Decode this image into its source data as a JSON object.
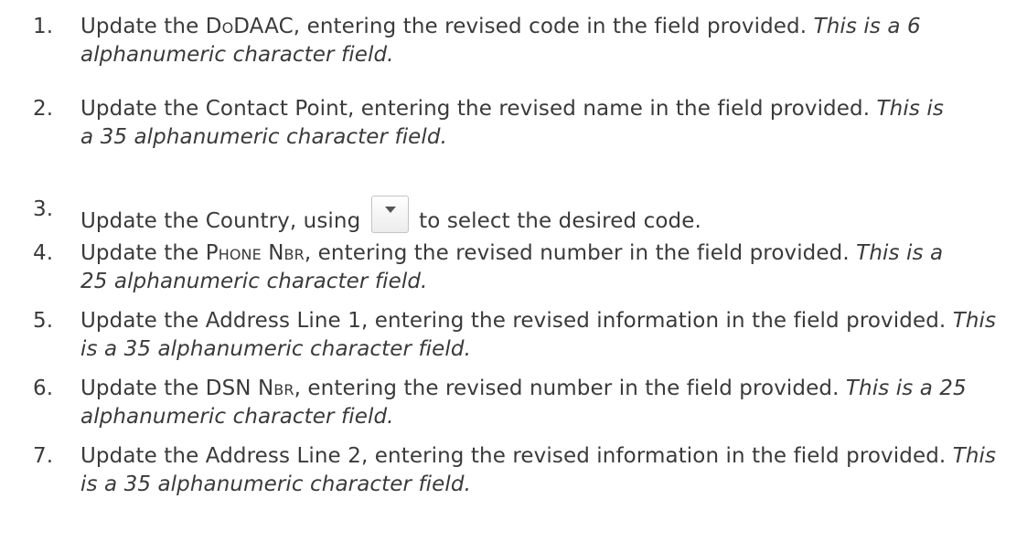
{
  "steps": [
    {
      "number": "1.",
      "pre": "Update the ",
      "term": "DoDAAC",
      "mid": ", entering the revised code in the field provided. ",
      "note": "This is a 6 alphanumeric character field."
    },
    {
      "number": "2.",
      "pre": "Update the Contact Point, entering the revised name in the field provided. ",
      "note": "This is a 35 alphanumeric character field."
    },
    {
      "number": "3.",
      "pre": "Update the Country, using",
      "icon": "dropdown-arrow-icon",
      "post": "to select the desired code."
    },
    {
      "number": "4.",
      "pre": "Update the ",
      "term": "Phone Nbr",
      "mid": ", entering the revised number in the field provided. ",
      "note": "This is a 25 alphanumeric character field."
    },
    {
      "number": "5.",
      "pre": "Update the Address Line 1, entering the revised information in the field provided. ",
      "note": "This is a 35 alphanumeric character field."
    },
    {
      "number": "6.",
      "pre": "Update the ",
      "term": "DSN Nbr",
      "mid": ", entering the revised number in the field provided. ",
      "note": "This is a 25 alphanumeric character field."
    },
    {
      "number": "7.",
      "pre": "Update the Address Line 2, entering the revised information in the field provided. ",
      "note": "This is a 35 alphanumeric character field."
    }
  ]
}
